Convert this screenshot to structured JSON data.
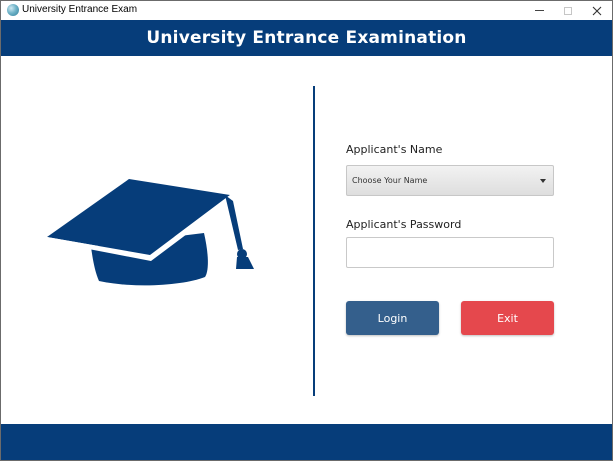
{
  "window": {
    "title": "University Entrance Exam",
    "controls": {
      "minimize": "minimize-icon",
      "maximize": "maximize-icon",
      "close": "close-icon"
    }
  },
  "header": {
    "title": "University Entrance Examination"
  },
  "form": {
    "name_label": "Applicant's Name",
    "name_select_value": "Choose Your Name",
    "password_label": "Applicant's Password",
    "password_value": ""
  },
  "buttons": {
    "login": "Login",
    "exit": "Exit"
  },
  "colors": {
    "brand": "#063d7a",
    "login_button": "#345f8c",
    "exit_button": "#e5484d"
  },
  "icons": {
    "hero": "graduation-cap-icon",
    "app": "globe-icon"
  }
}
